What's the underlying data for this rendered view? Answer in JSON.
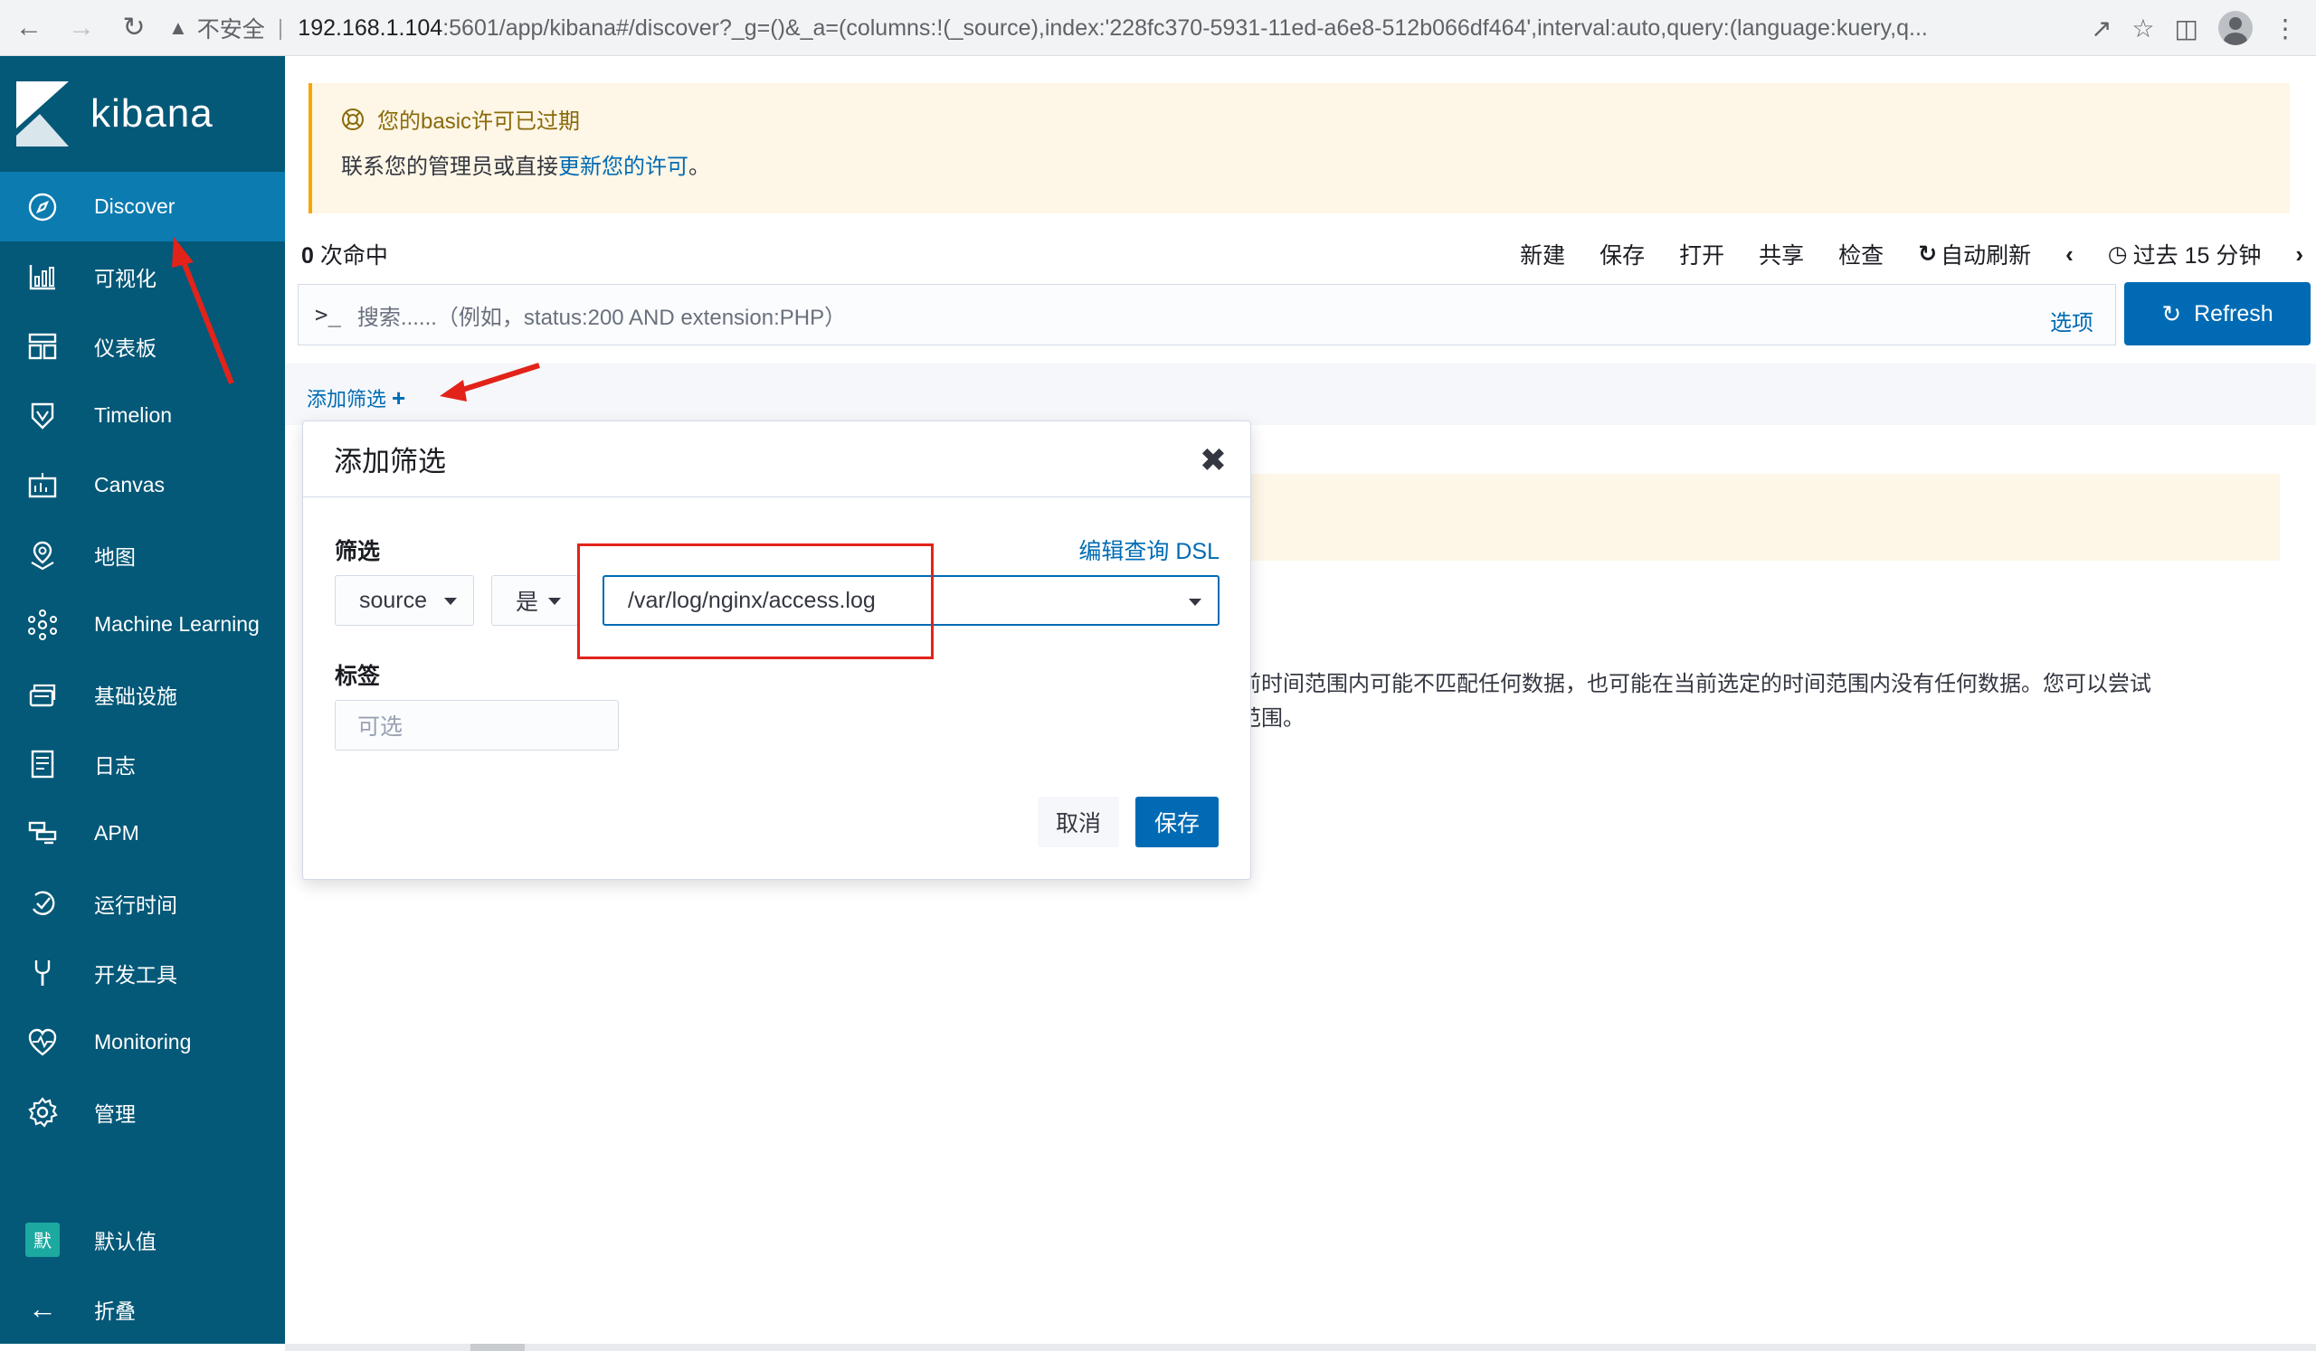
{
  "browser": {
    "insecure_label": "不安全",
    "url_host": "192.168.1.104",
    "url_path": ":5601/app/kibana#/discover?_g=()&_a=(columns:!(_source),index:'228fc370-5931-11ed-a6e8-512b066df464',interval:auto,query:(language:kuery,q..."
  },
  "sidebar": {
    "logo_text": "kibana",
    "items": [
      {
        "label": "Discover",
        "icon": "compass-icon",
        "active": true
      },
      {
        "label": "可视化",
        "icon": "visualize-icon"
      },
      {
        "label": "仪表板",
        "icon": "dashboard-icon"
      },
      {
        "label": "Timelion",
        "icon": "timelion-icon"
      },
      {
        "label": "Canvas",
        "icon": "canvas-icon"
      },
      {
        "label": "地图",
        "icon": "map-icon"
      },
      {
        "label": "Machine Learning",
        "icon": "ml-icon"
      },
      {
        "label": "基础设施",
        "icon": "infra-icon"
      },
      {
        "label": "日志",
        "icon": "logs-icon"
      },
      {
        "label": "APM",
        "icon": "apm-icon"
      },
      {
        "label": "运行时间",
        "icon": "uptime-icon"
      },
      {
        "label": "开发工具",
        "icon": "devtools-icon"
      },
      {
        "label": "Monitoring",
        "icon": "monitoring-icon"
      },
      {
        "label": "管理",
        "icon": "gear-icon"
      }
    ],
    "space_badge": "默",
    "space_label": "默认值",
    "collapse_label": "折叠"
  },
  "license": {
    "title": "您的basic许可已过期",
    "body_prefix": "联系您的管理员或直接",
    "body_link": "更新您的许可",
    "body_suffix": "。"
  },
  "topnav": {
    "hits_count": "0",
    "hits_label": " 次命中",
    "menu": [
      "新建",
      "保存",
      "打开",
      "共享",
      "检查"
    ],
    "auto_refresh": "自动刷新",
    "time_range": "过去 15 分钟"
  },
  "search": {
    "prompt": ">_",
    "placeholder": "搜索......（例如，status:200 AND extension:PHP）",
    "options_label": "选项",
    "refresh_label": "Refresh"
  },
  "filter_bar": {
    "add_filter_label": "添加筛选"
  },
  "no_results": {
    "line1": "前时间范围内可能不匹配任何数据，也可能在当前选定的时间范围内没有任何数据。您可以尝试",
    "line2": "范围。"
  },
  "popover": {
    "title": "添加筛选",
    "filter_label": "筛选",
    "edit_dsl": "编辑查询 DSL",
    "field_value": "source",
    "operator_value": "是",
    "value_value": "/var/log/nginx/access.log",
    "tag_label": "标签",
    "tag_placeholder": "可选",
    "cancel_label": "取消",
    "save_label": "保存"
  },
  "colors": {
    "sidebar_bg": "#045878",
    "active_item": "#0b7bb0",
    "primary": "#006bb4",
    "annotation_red": "#e2231a"
  }
}
